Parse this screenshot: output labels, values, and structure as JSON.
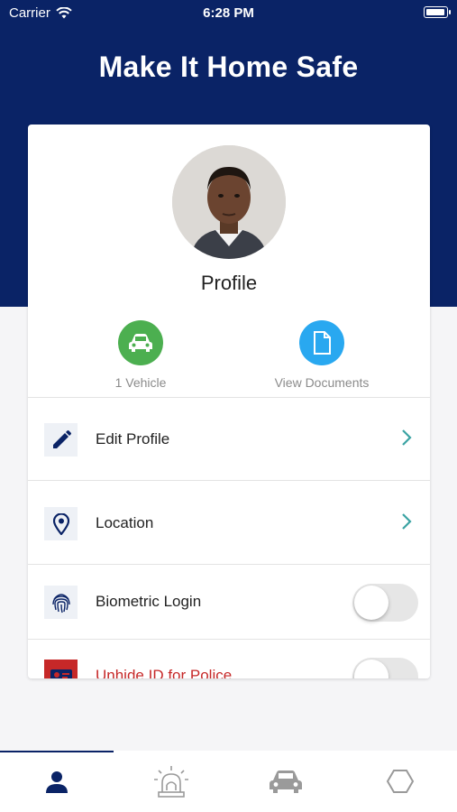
{
  "status_bar": {
    "carrier": "Carrier",
    "time": "6:28 PM"
  },
  "app": {
    "title": "Make It Home Safe"
  },
  "profile": {
    "title": "Profile",
    "quick_actions": [
      {
        "label": "1 Vehicle",
        "icon": "car-icon",
        "color": "#4caf50"
      },
      {
        "label": "View Documents",
        "icon": "document-icon",
        "color": "#29a8f0"
      }
    ]
  },
  "menu": {
    "items": [
      {
        "label": "Edit Profile",
        "icon": "pencil-icon",
        "control": "chevron"
      },
      {
        "label": "Location",
        "icon": "location-pin-icon",
        "control": "chevron"
      },
      {
        "label": "Biometric Login",
        "icon": "fingerprint-icon",
        "control": "toggle",
        "enabled": false
      },
      {
        "label": "Unhide ID for Police",
        "icon": "id-card-icon",
        "control": "toggle",
        "enabled": false,
        "color": "#c62828"
      }
    ]
  },
  "tabbar": {
    "tabs": [
      {
        "icon": "person-icon",
        "active": true
      },
      {
        "icon": "siren-icon",
        "active": false
      },
      {
        "icon": "car-icon",
        "active": false
      },
      {
        "icon": "hexagon-icon",
        "active": false
      }
    ]
  },
  "colors": {
    "brand": "#0a2366",
    "accent_teal": "#3aa3a3",
    "danger": "#c62828"
  }
}
